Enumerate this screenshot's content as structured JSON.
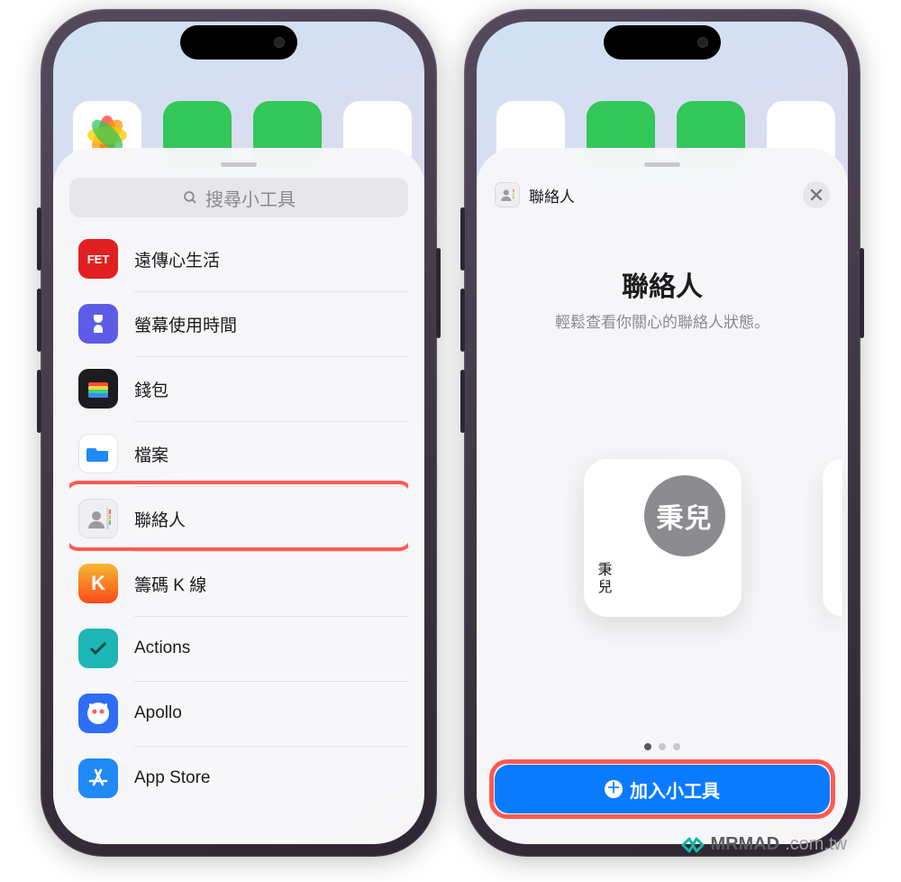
{
  "search": {
    "placeholder": "搜尋小工具"
  },
  "apps": [
    {
      "key": "fet",
      "label": "遠傳心生活"
    },
    {
      "key": "screen",
      "label": "螢幕使用時間"
    },
    {
      "key": "wallet",
      "label": "錢包"
    },
    {
      "key": "files",
      "label": "檔案"
    },
    {
      "key": "contacts",
      "label": "聯絡人"
    },
    {
      "key": "k",
      "label": "籌碼 K 線"
    },
    {
      "key": "actions",
      "label": "Actions"
    },
    {
      "key": "apollo",
      "label": "Apollo"
    },
    {
      "key": "appstore",
      "label": "App Store"
    }
  ],
  "detail": {
    "header_label": "聯絡人",
    "title": "聯絡人",
    "subtitle": "輕鬆查看你關心的聯絡人狀態。",
    "preview_contact_avatar": "秉兒",
    "preview_contact_name": "秉兒",
    "page_index": 0,
    "page_count": 3,
    "add_button": "加入小工具"
  },
  "watermark": {
    "brand": "MRMAD",
    "domain": ".com.tw"
  },
  "icon_text": {
    "fet": "FET"
  }
}
